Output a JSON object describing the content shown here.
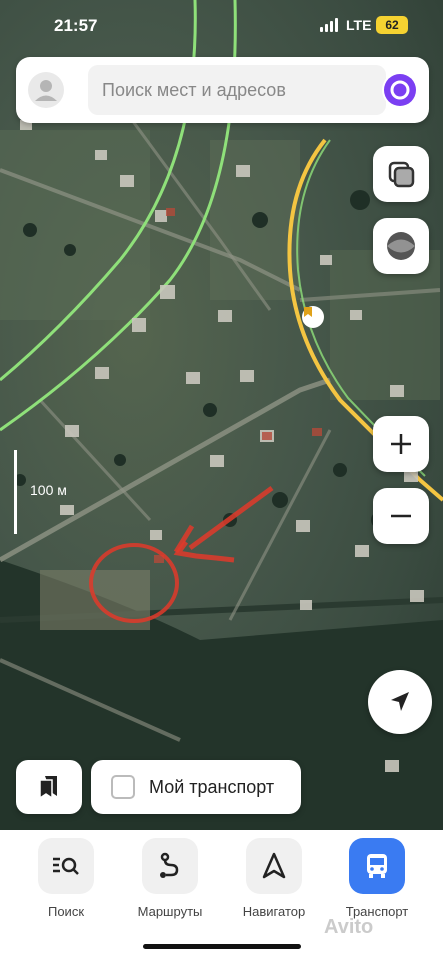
{
  "status": {
    "time": "21:57",
    "network": "LTE",
    "battery": "62"
  },
  "search": {
    "placeholder": "Поиск мест и адресов"
  },
  "map": {
    "scale_label": "100 м"
  },
  "bottom_pills": {
    "my_transport_label": "Мой транспорт"
  },
  "tabs": [
    {
      "label": "Поиск",
      "icon": "search-list-icon"
    },
    {
      "label": "Маршруты",
      "icon": "route-icon"
    },
    {
      "label": "Навигатор",
      "icon": "navigator-arrow-icon"
    },
    {
      "label": "Транспорт",
      "icon": "bus-icon",
      "active": true
    }
  ],
  "watermark": "Avito",
  "colors": {
    "accent": "#3a7bf2",
    "alice": "#7b3ff2",
    "battery": "#f5d231",
    "annotation": "#e03a2a"
  }
}
